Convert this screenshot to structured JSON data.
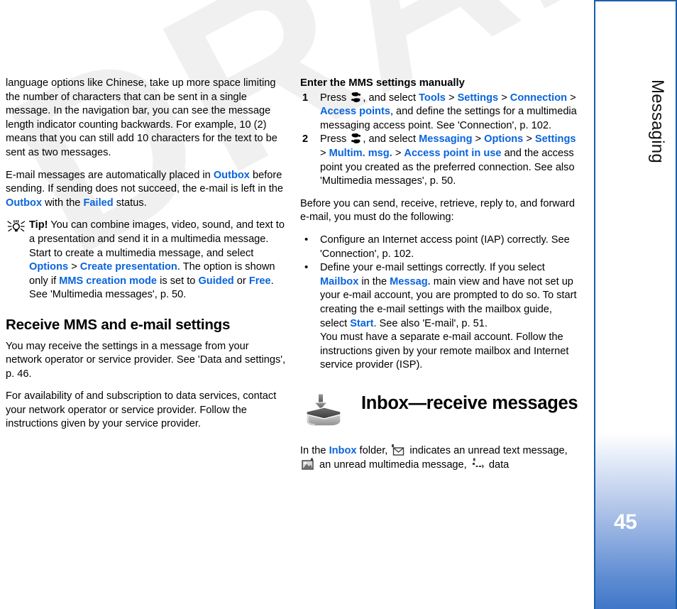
{
  "document": {
    "watermark": "DRAFT",
    "accent_blue": "#0a64dc",
    "sidebar_border": "#1a5fad",
    "sidebar_gradient_end": "#3f76c8"
  },
  "sidebar": {
    "chapter_label": "Messaging",
    "page_number": "45"
  },
  "left_column": {
    "para_continuation": {
      "text": "language options like Chinese, take up more space limiting the number of characters that can be sent in a single message. In the navigation bar, you can see the message length indicator counting backwards. For example, 10 (2) means that you can still add 10 characters for the text to be sent as two messages."
    },
    "para_email_outbox": {
      "part1": "E-mail messages are automatically placed in ",
      "link1": "Outbox",
      "part2": " before sending. If sending does not succeed, the e-mail is left in the ",
      "link2": "Outbox",
      "part3": " with the ",
      "link3": "Failed",
      "part4": " status."
    },
    "tip": {
      "icon": "lightbulb-tip-icon",
      "label": "Tip!",
      "part1": " You can combine images, video, sound, and text to a presentation and send it in a multimedia message. Start to create a multimedia message, and select ",
      "link1": "Options",
      "sep1": " > ",
      "link2": "Create presentation",
      "part2": ". The option is shown only if ",
      "link3": "MMS creation mode",
      "part3": " is set to ",
      "link4": "Guided",
      "part4": " or ",
      "link5": "Free",
      "part5": ". See 'Multimedia messages', p. 50."
    },
    "heading_receive": "Receive MMS and e-mail settings",
    "para_may_receive": "You may receive the settings in a message from your network operator or service provider. See 'Data and settings', p. 46.",
    "para_availability": "For availability of and subscription to data services, contact your network operator or service provider. Follow the instructions given by your service provider."
  },
  "right_column": {
    "subheading_manual": "Enter the MMS settings manually",
    "steps": [
      {
        "number": "1",
        "press_label": "Press",
        "key_icon": "nokia-menu-key-icon",
        "after_key": ", and select ",
        "links": [
          "Tools",
          "Settings",
          "Connection",
          "Access points"
        ],
        "tail": ", and define the settings for a multimedia messaging access point. See 'Connection', p. 102."
      },
      {
        "number": "2",
        "press_label": "Press",
        "key_icon": "nokia-menu-key-icon",
        "after_key": ", and select ",
        "links": [
          "Messaging",
          "Options",
          "Settings",
          "Multim. msg.",
          "Access point in use"
        ],
        "tail": " and the access point you created as the preferred connection. See also 'Multimedia messages', p. 50."
      }
    ],
    "para_before_you_can": "Before you can send, receive, retrieve, reply to, and forward e-mail, you must do the following:",
    "bullets": [
      {
        "bullet": "•",
        "text": "Configure an Internet access point (IAP) correctly. See 'Connection', p. 102."
      },
      {
        "bullet": "•",
        "part1": "Define your e-mail settings correctly. If you select ",
        "link1": "Mailbox",
        "part2": " in the ",
        "link2": "Messag.",
        "part3": " main view and have not set up your e-mail account, you are prompted to do so. To start creating the e-mail settings with the mailbox guide, select ",
        "link3": "Start",
        "part4": ". See also 'E-mail', p. 51.",
        "part5": "You must have a separate e-mail account. Follow the instructions given by your remote mailbox and Internet service provider (ISP)."
      }
    ],
    "chapter": {
      "icon": "inbox-tray-icon",
      "title": "Inbox—receive messages"
    },
    "para_inbox_folder": {
      "part1": "In the ",
      "link1": "Inbox",
      "part2": " folder, ",
      "icon1": "unread-text-message-icon",
      "part3": " indicates an unread text message, ",
      "icon2": "unread-multimedia-message-icon",
      "part4": " an unread multimedia message, ",
      "icon3": "data-message-icon",
      "part5": " data"
    }
  }
}
